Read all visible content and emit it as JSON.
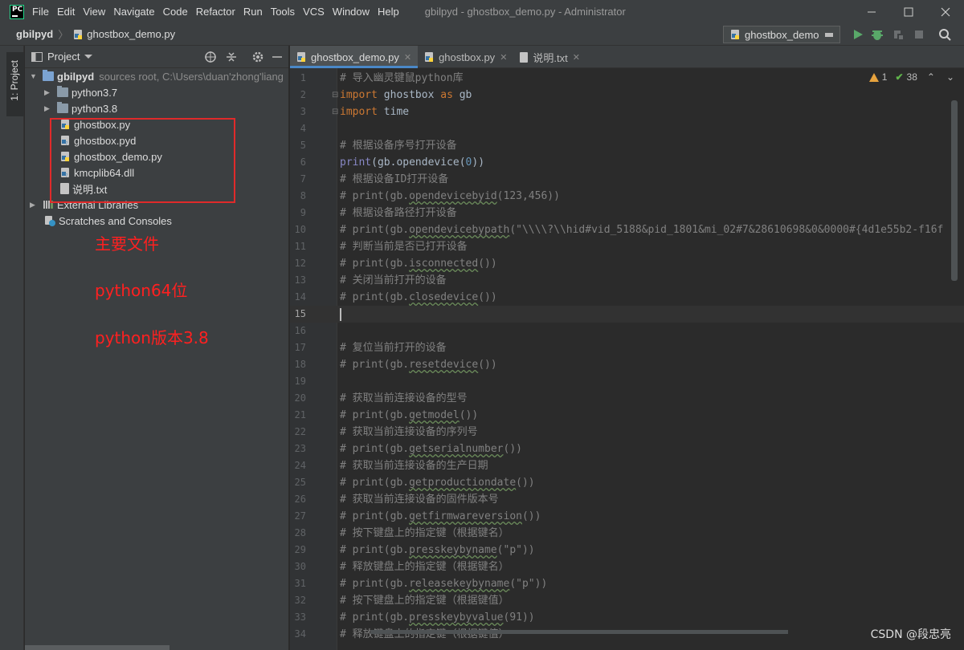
{
  "menubar": {
    "items": [
      "File",
      "Edit",
      "View",
      "Navigate",
      "Code",
      "Refactor",
      "Run",
      "Tools",
      "VCS",
      "Window",
      "Help"
    ],
    "title": "gbilpyd - ghostbox_demo.py - Administrator"
  },
  "navbar": {
    "root": "gbilpyd",
    "file": "ghostbox_demo.py",
    "run_config": "ghostbox_demo"
  },
  "toolstrip": {
    "tab_label": "1: Project"
  },
  "project": {
    "header": "Project",
    "root": {
      "name": "gbilpyd",
      "note": "sources root,  C:\\Users\\duan'zhong'liang"
    },
    "folders": [
      "python3.7",
      "python3.8"
    ],
    "files": [
      "ghostbox.py",
      "ghostbox.pyd",
      "ghostbox_demo.py",
      "kmcplib64.dll",
      "说明.txt"
    ],
    "external": "External Libraries",
    "scratches": "Scratches and Consoles"
  },
  "annotations": [
    "主要文件",
    "python64位",
    "python版本3.8"
  ],
  "tabs": [
    "ghostbox_demo.py",
    "ghostbox.py",
    "说明.txt"
  ],
  "inspection": {
    "warnings": "1",
    "weak": "38"
  },
  "code_lines": [
    "# 导入幽灵键鼠python库",
    "import ghostbox as gb",
    "import time",
    "",
    "# 根据设备序号打开设备",
    "print(gb.opendevice(0))",
    "# 根据设备ID打开设备",
    "# print(gb.opendevicebyid(123,456))",
    "# 根据设备路径打开设备",
    "# print(gb.opendevicebypath(\"\\\\\\\\?\\\\hid#vid_5188&pid_1801&mi_02#7&28610698&0&0000#{4d1e55b2-f16f",
    "# 判断当前是否已打开设备",
    "# print(gb.isconnected())",
    "# 关闭当前打开的设备",
    "# print(gb.closedevice())",
    "",
    "",
    "# 复位当前打开的设备",
    "# print(gb.resetdevice())",
    "",
    "# 获取当前连接设备的型号",
    "# print(gb.getmodel())",
    "# 获取当前连接设备的序列号",
    "# print(gb.getserialnumber())",
    "# 获取当前连接设备的生产日期",
    "# print(gb.getproductiondate())",
    "# 获取当前连接设备的固件版本号",
    "# print(gb.getfirmwareversion())",
    "# 按下键盘上的指定键（根据键名）",
    "# print(gb.presskeybyname(\"p\"))",
    "# 释放键盘上的指定键（根据键名）",
    "# print(gb.releasekeybyname(\"p\"))",
    "# 按下键盘上的指定键（根据键值）",
    "# print(gb.presskeybyvalue(91))",
    "# 释放键盘上的指定键（根据键值）"
  ],
  "watermark": "CSDN @段忠亮"
}
